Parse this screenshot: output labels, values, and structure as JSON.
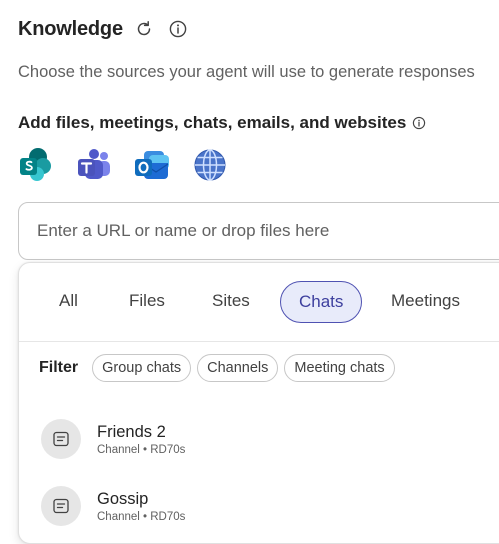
{
  "header": {
    "title": "Knowledge",
    "subtitle": "Choose the sources your agent will use to generate responses",
    "refresh_icon": "refresh-icon",
    "info_icon": "info-icon"
  },
  "section": {
    "title": "Add files, meetings, chats, emails, and websites",
    "info_icon": "info-icon"
  },
  "sources": [
    {
      "name": "SharePoint",
      "icon": "sharepoint-icon",
      "color": "#038387"
    },
    {
      "name": "Teams",
      "icon": "teams-icon",
      "color": "#5b5fc7"
    },
    {
      "name": "Outlook",
      "icon": "outlook-icon",
      "color": "#0f6cbd"
    },
    {
      "name": "Website",
      "icon": "globe-icon",
      "color": "#4a74c9"
    }
  ],
  "search": {
    "placeholder": "Enter a URL or name or drop files here",
    "value": ""
  },
  "tabs": [
    {
      "label": "All",
      "active": false
    },
    {
      "label": "Files",
      "active": false
    },
    {
      "label": "Sites",
      "active": false
    },
    {
      "label": "Chats",
      "active": true
    },
    {
      "label": "Meetings",
      "active": false
    }
  ],
  "filter": {
    "label": "Filter",
    "chips": [
      "Group chats",
      "Channels",
      "Meeting chats"
    ]
  },
  "results": [
    {
      "name": "Friends 2",
      "meta": "Channel • RD70s",
      "icon": "channel-icon"
    },
    {
      "name": "Gossip",
      "meta": "Channel • RD70s",
      "icon": "channel-icon"
    }
  ],
  "colors": {
    "accent": "#4f52b2",
    "accent_bg": "#e8ebfa",
    "text": "#242424",
    "muted": "#616161"
  }
}
